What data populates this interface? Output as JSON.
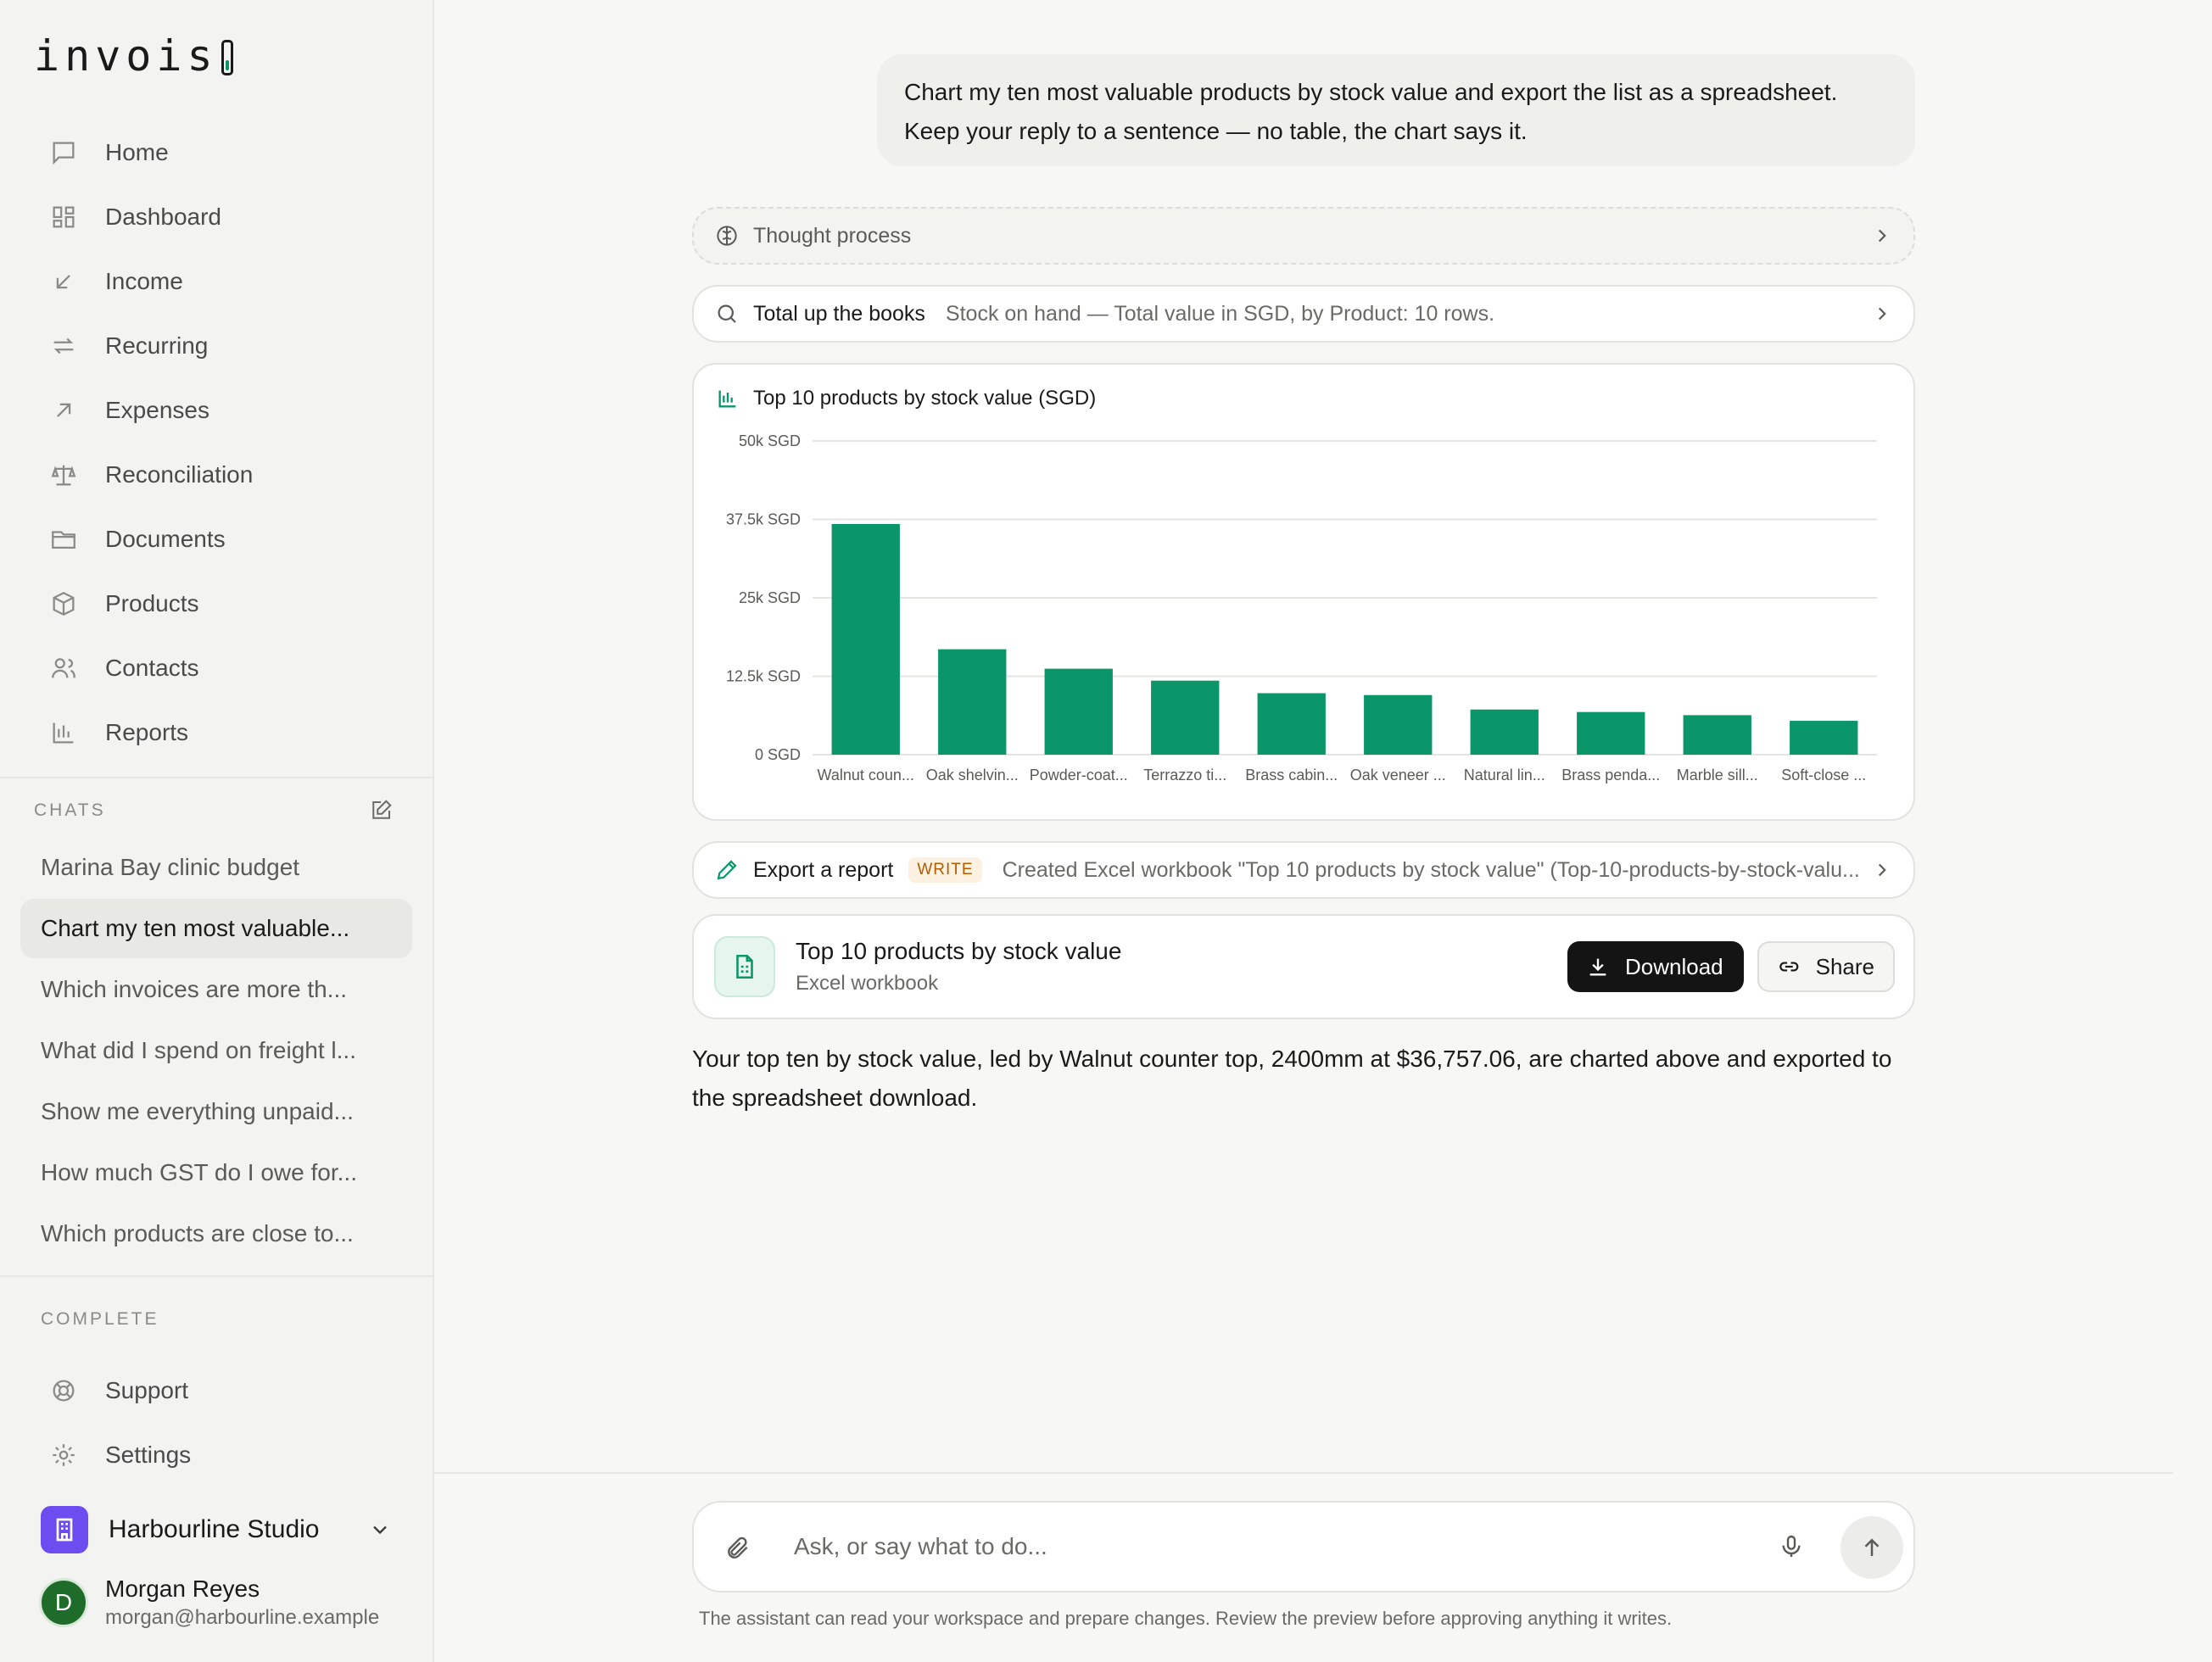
{
  "app": {
    "logo_text": "invois"
  },
  "sidebar": {
    "nav": [
      {
        "label": "Home",
        "icon": "chat-bubble-icon"
      },
      {
        "label": "Dashboard",
        "icon": "dashboard-icon"
      },
      {
        "label": "Income",
        "icon": "arrow-down-left-icon"
      },
      {
        "label": "Recurring",
        "icon": "repeat-icon"
      },
      {
        "label": "Expenses",
        "icon": "arrow-up-right-icon"
      },
      {
        "label": "Reconciliation",
        "icon": "scales-icon"
      },
      {
        "label": "Documents",
        "icon": "folder-icon"
      },
      {
        "label": "Products",
        "icon": "box-icon"
      },
      {
        "label": "Contacts",
        "icon": "users-icon"
      },
      {
        "label": "Reports",
        "icon": "bar-chart-icon"
      }
    ],
    "chats_label": "CHATS",
    "chats": [
      {
        "label": "Marina Bay clinic budget",
        "active": false
      },
      {
        "label": "Chart my ten most valuable...",
        "active": true
      },
      {
        "label": "Which invoices are more th...",
        "active": false
      },
      {
        "label": "What did I spend on freight l...",
        "active": false
      },
      {
        "label": "Show me everything unpaid...",
        "active": false
      },
      {
        "label": "How much GST do I owe for...",
        "active": false
      },
      {
        "label": "Which products are close to...",
        "active": false
      }
    ],
    "complete_label": "COMPLETE",
    "bottom_nav": [
      {
        "label": "Support",
        "icon": "lifebuoy-icon"
      },
      {
        "label": "Settings",
        "icon": "gear-icon"
      }
    ],
    "workspace": {
      "name": "Harbourline Studio"
    },
    "user": {
      "initial": "D",
      "name": "Morgan Reyes",
      "email": "morgan@harbourline.example"
    }
  },
  "conversation": {
    "user_message": "Chart my ten most valuable products by stock value and export the list as a spreadsheet. Keep your reply to a sentence — no table, the chart says it.",
    "thought_label": "Thought process",
    "tool_query": {
      "title": "Total up the books",
      "detail": "Stock on hand — Total value in SGD, by Product: 10 rows."
    },
    "tool_export": {
      "title": "Export a report",
      "badge": "WRITE",
      "detail": "Created Excel workbook \"Top 10 products by stock value\" (Top-10-products-by-stock-valu..."
    },
    "file": {
      "name": "Top 10 products by stock value",
      "type": "Excel workbook",
      "download_label": "Download",
      "share_label": "Share"
    },
    "reply": "Your top ten by stock value, led by Walnut counter top, 2400mm at $36,757.06, are charted above and exported to the spreadsheet download."
  },
  "chart_data": {
    "type": "bar",
    "title": "Top 10 products by stock value (SGD)",
    "categories": [
      "Walnut coun...",
      "Oak shelvin...",
      "Powder-coat...",
      "Terrazzo ti...",
      "Brass cabin...",
      "Oak veneer ...",
      "Natural lin...",
      "Brass penda...",
      "Marble sill...",
      "Soft-close ..."
    ],
    "values": [
      36757.06,
      16800,
      13700,
      11800,
      9800,
      9500,
      7200,
      6800,
      6300,
      5400
    ],
    "ylim": [
      0,
      50000
    ],
    "yticks": [
      0,
      12500,
      25000,
      37500,
      50000
    ],
    "ytick_labels": [
      "0 SGD",
      "12.5k SGD",
      "25k SGD",
      "37.5k SGD",
      "50k SGD"
    ],
    "grid": true,
    "bar_color": "#0a9669"
  },
  "composer": {
    "placeholder": "Ask, or say what to do...",
    "disclaimer": "The assistant can read your workspace and prepare changes. Review the preview before approving anything it writes."
  },
  "colors": {
    "accent": "#0a9669",
    "workspace_logo": "#6d4cf0",
    "avatar": "#1f6b2a",
    "write_badge": "#b35c00"
  }
}
